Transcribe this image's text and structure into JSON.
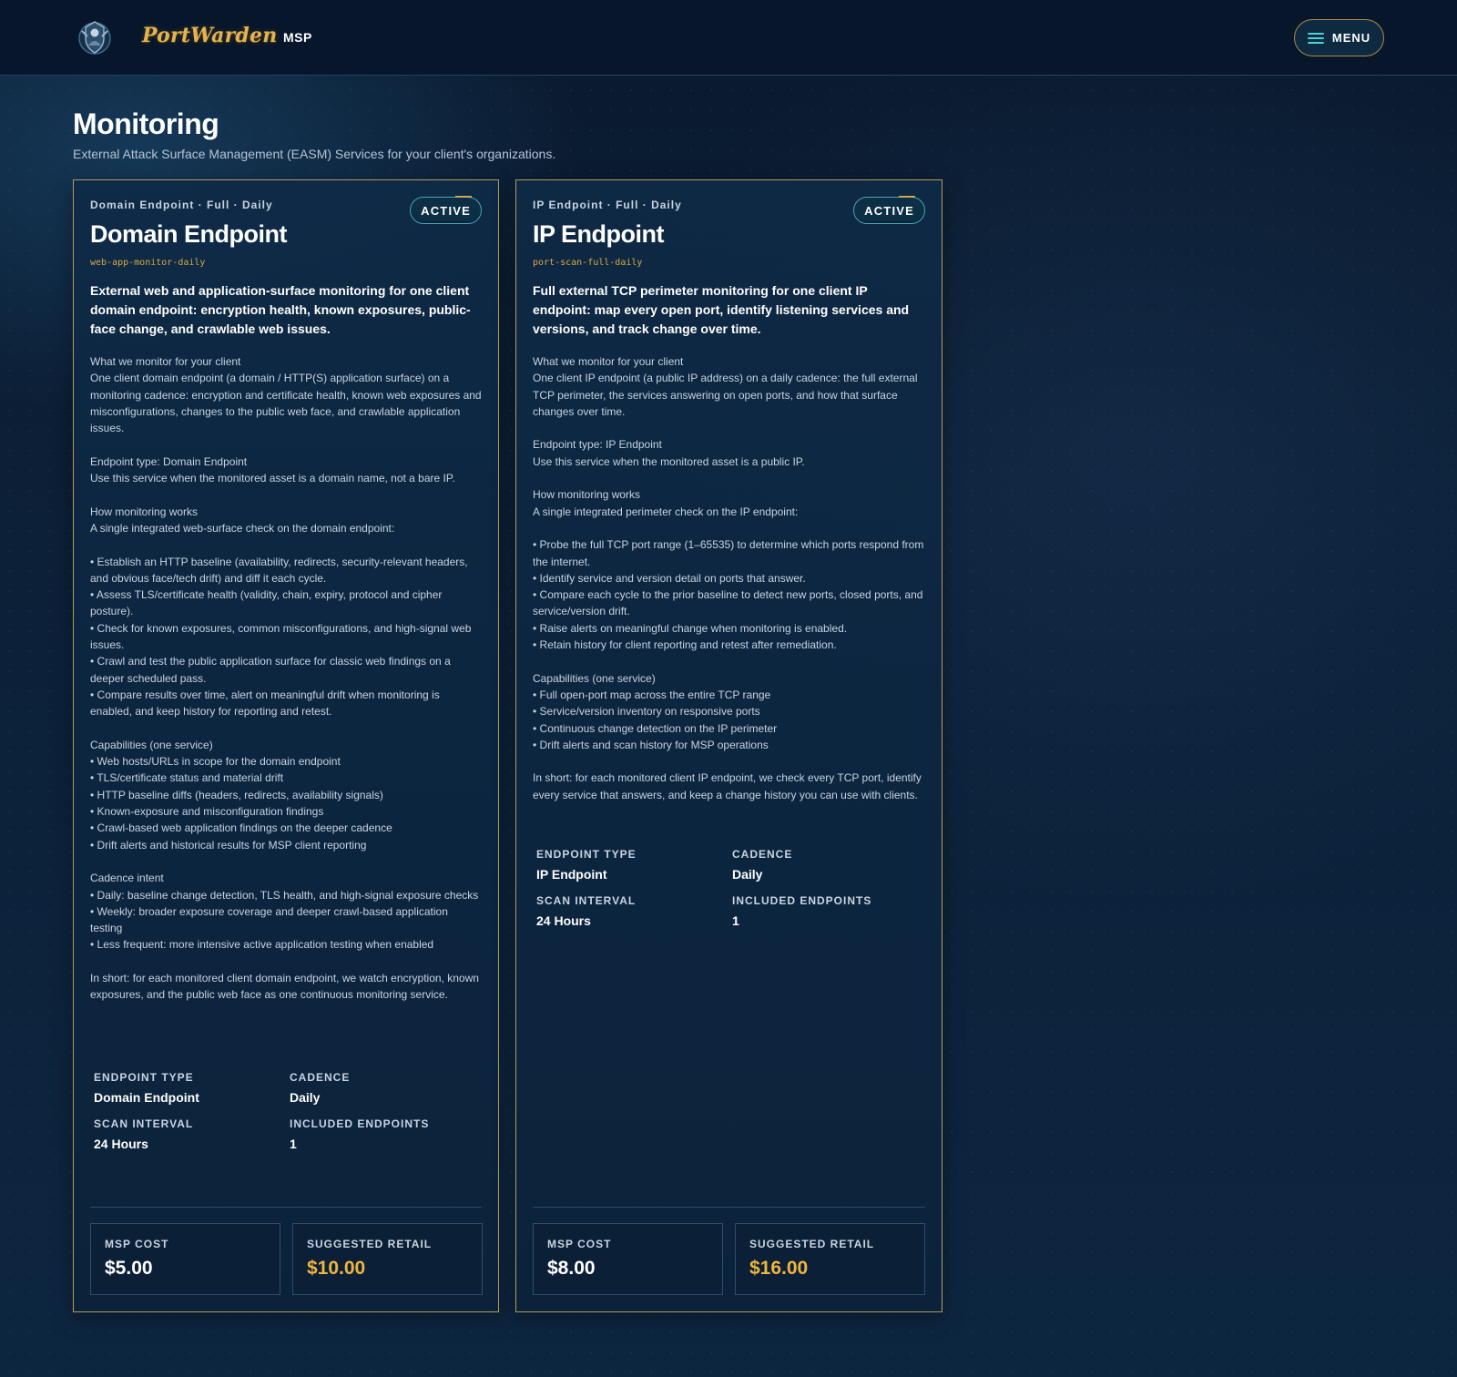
{
  "header": {
    "brand": "PortWarden",
    "brand_suffix": "MSP",
    "menu_label": "MENU"
  },
  "page": {
    "title": "Monitoring",
    "subtitle": "External Attack Surface Management (EASM) Services for your client's organizations."
  },
  "colors": {
    "accent_gold": "#f0b53f",
    "accent_teal": "#4fd2d8",
    "card_border": "#b59a5e"
  },
  "cards": [
    {
      "kicker": "Domain Endpoint · Full · Daily",
      "status": "ACTIVE",
      "title": "Domain Endpoint",
      "slug": "web-app-monitor-daily",
      "lead": "External web and application-surface monitoring for one client domain endpoint: encryption health, known exposures, public-face change, and crawlable web issues.",
      "body": "What we monitor for your client\nOne client domain endpoint (a domain / HTTP(S) application surface) on a monitoring cadence: encryption and certificate health, known web exposures and misconfigurations, changes to the public web face, and crawlable application issues.\n\nEndpoint type: Domain Endpoint\nUse this service when the monitored asset is a domain name, not a bare IP.\n\nHow monitoring works\nA single integrated web-surface check on the domain endpoint:\n\n• Establish an HTTP baseline (availability, redirects, security-relevant headers, and obvious face/tech drift) and diff it each cycle.\n• Assess TLS/certificate health (validity, chain, expiry, protocol and cipher posture).\n• Check for known exposures, common misconfigurations, and high-signal web issues.\n• Crawl and test the public application surface for classic web findings on a deeper scheduled pass.\n• Compare results over time, alert on meaningful drift when monitoring is enabled, and keep history for reporting and retest.\n\nCapabilities (one service)\n• Web hosts/URLs in scope for the domain endpoint\n• TLS/certificate status and material drift\n• HTTP baseline diffs (headers, redirects, availability signals)\n• Known-exposure and misconfiguration findings\n• Crawl-based web application findings on the deeper cadence\n• Drift alerts and historical results for MSP client reporting\n\nCadence intent\n• Daily: baseline change detection, TLS health, and high-signal exposure checks\n• Weekly: broader exposure coverage and deeper crawl-based application testing\n• Less frequent: more intensive active application testing when enabled\n\nIn short: for each monitored client domain endpoint, we watch encryption, known exposures, and the public web face as one continuous monitoring service.",
      "specs": [
        {
          "label": "ENDPOINT TYPE",
          "value": "Domain Endpoint"
        },
        {
          "label": "CADENCE",
          "value": "Daily"
        },
        {
          "label": "SCAN INTERVAL",
          "value": "24 Hours"
        },
        {
          "label": "INCLUDED ENDPOINTS",
          "value": "1"
        }
      ],
      "msp_cost_label": "MSP COST",
      "msp_cost": "$5.00",
      "retail_label": "SUGGESTED RETAIL",
      "retail": "$10.00"
    },
    {
      "kicker": "IP Endpoint · Full · Daily",
      "status": "ACTIVE",
      "title": "IP Endpoint",
      "slug": "port-scan-full-daily",
      "lead": "Full external TCP perimeter monitoring for one client IP endpoint: map every open port, identify listening services and versions, and track change over time.",
      "body": "What we monitor for your client\nOne client IP endpoint (a public IP address) on a daily cadence: the full external TCP perimeter, the services answering on open ports, and how that surface changes over time.\n\nEndpoint type: IP Endpoint\nUse this service when the monitored asset is a public IP.\n\nHow monitoring works\nA single integrated perimeter check on the IP endpoint:\n\n• Probe the full TCP port range (1–65535) to determine which ports respond from the internet.\n• Identify service and version detail on ports that answer.\n• Compare each cycle to the prior baseline to detect new ports, closed ports, and service/version drift.\n• Raise alerts on meaningful change when monitoring is enabled.\n• Retain history for client reporting and retest after remediation.\n\nCapabilities (one service)\n• Full open-port map across the entire TCP range\n• Service/version inventory on responsive ports\n• Continuous change detection on the IP perimeter\n• Drift alerts and scan history for MSP operations\n\nIn short: for each monitored client IP endpoint, we check every TCP port, identify every service that answers, and keep a change history you can use with clients.",
      "specs": [
        {
          "label": "ENDPOINT TYPE",
          "value": "IP Endpoint"
        },
        {
          "label": "CADENCE",
          "value": "Daily"
        },
        {
          "label": "SCAN INTERVAL",
          "value": "24 Hours"
        },
        {
          "label": "INCLUDED ENDPOINTS",
          "value": "1"
        }
      ],
      "msp_cost_label": "MSP COST",
      "msp_cost": "$8.00",
      "retail_label": "SUGGESTED RETAIL",
      "retail": "$16.00"
    }
  ]
}
